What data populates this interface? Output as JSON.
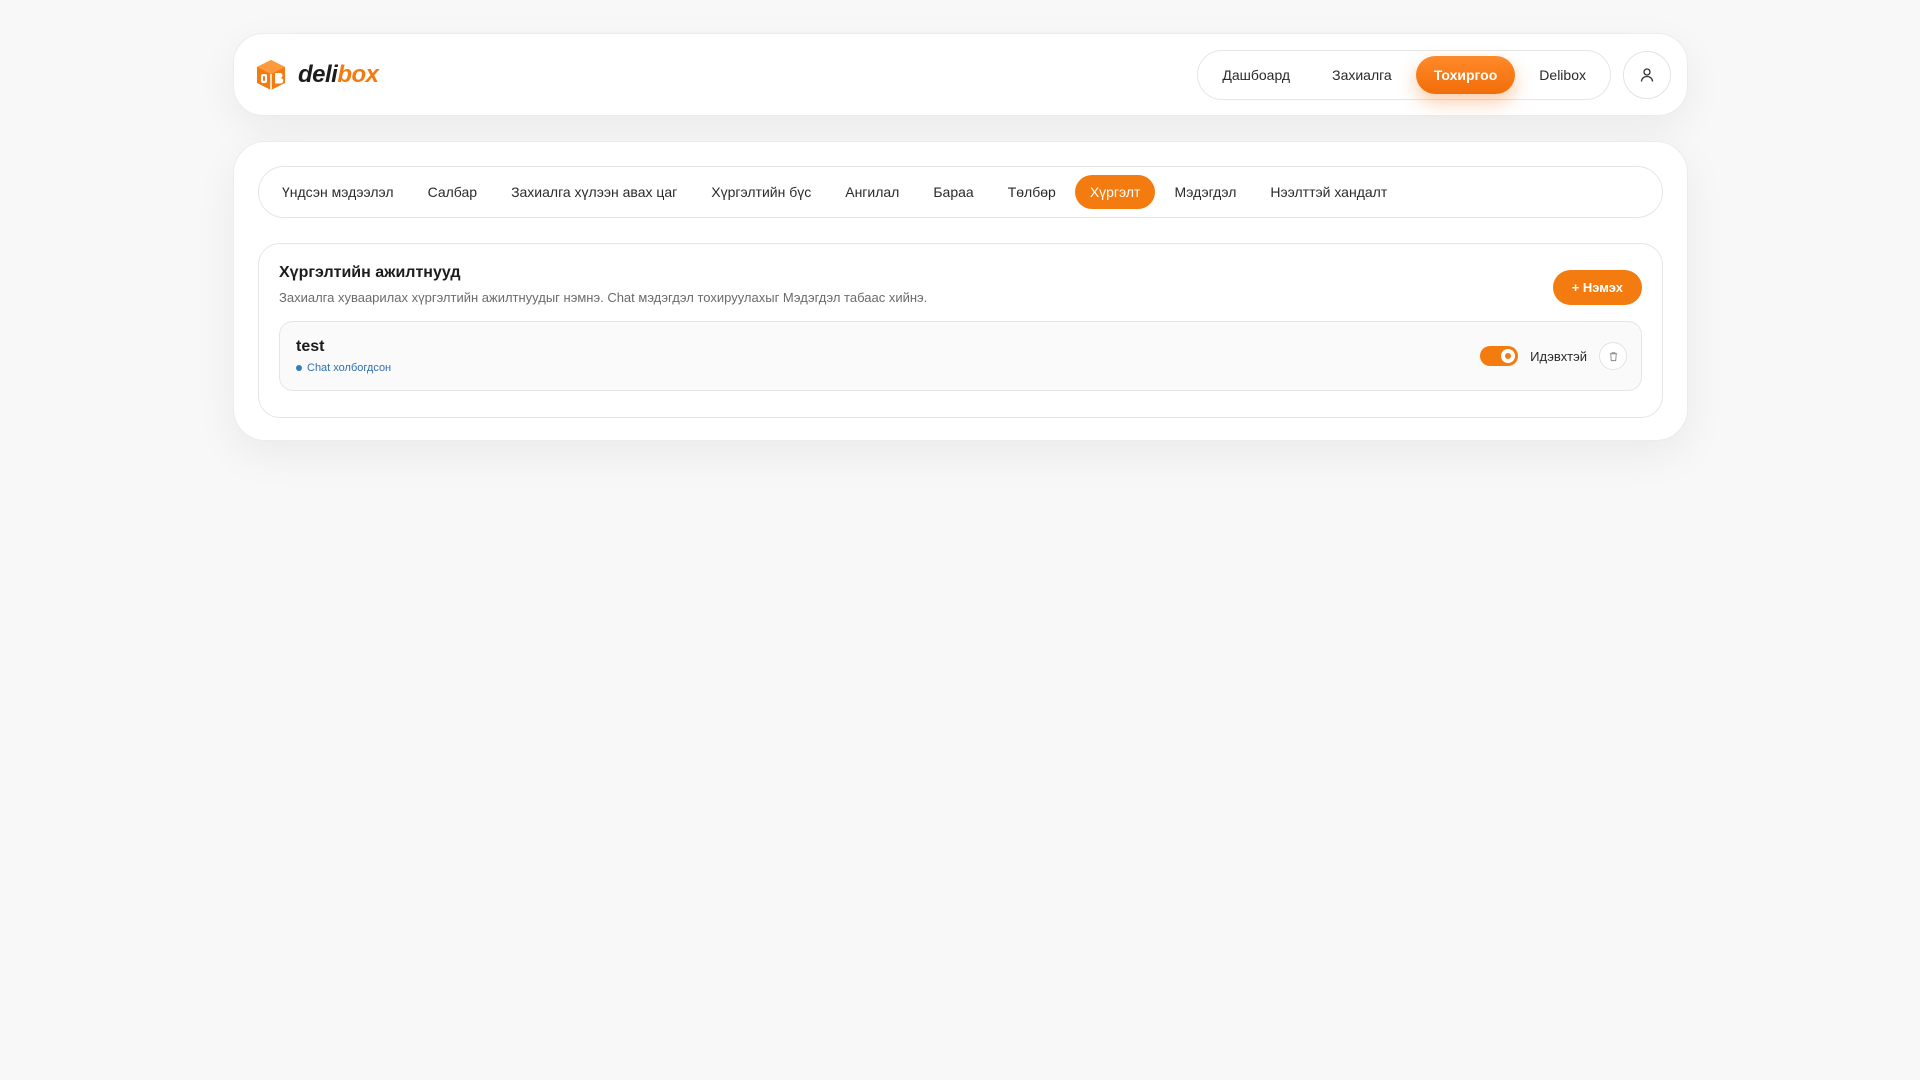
{
  "brand": {
    "name_part1": "deli",
    "name_part2": "box",
    "accent_color": "#f47b10"
  },
  "nav": {
    "items": [
      {
        "label": "Дашбоард",
        "active": false
      },
      {
        "label": "Захиалга",
        "active": false
      },
      {
        "label": "Тохиргоо",
        "active": true
      },
      {
        "label": "Delibox",
        "active": false
      }
    ],
    "user_icon": "user-icon"
  },
  "tabs": [
    {
      "label": "Үндсэн мэдээлэл",
      "active": false
    },
    {
      "label": "Салбар",
      "active": false
    },
    {
      "label": "Захиалга хүлээн авах цаг",
      "active": false
    },
    {
      "label": "Хүргэлтийн бүс",
      "active": false
    },
    {
      "label": "Ангилал",
      "active": false
    },
    {
      "label": "Бараа",
      "active": false
    },
    {
      "label": "Төлбөр",
      "active": false
    },
    {
      "label": "Хүргэлт",
      "active": true
    },
    {
      "label": "Мэдэгдэл",
      "active": false
    },
    {
      "label": "Нээлттэй хандалт",
      "active": false
    }
  ],
  "section": {
    "title": "Хүргэлтийн ажилтнууд",
    "description": "Захиалга хуваарилах хүргэлтийн ажилтнуудыг нэмнэ. Chat мэдэгдэл тохируулахыг Мэдэгдэл табаас хийнэ.",
    "add_label": "+ Нэмэх"
  },
  "employees": [
    {
      "name": "test",
      "status": "Chat холбогдсон",
      "active": true,
      "active_label": "Идэвхтэй",
      "delete_icon": "trash-icon"
    }
  ]
}
